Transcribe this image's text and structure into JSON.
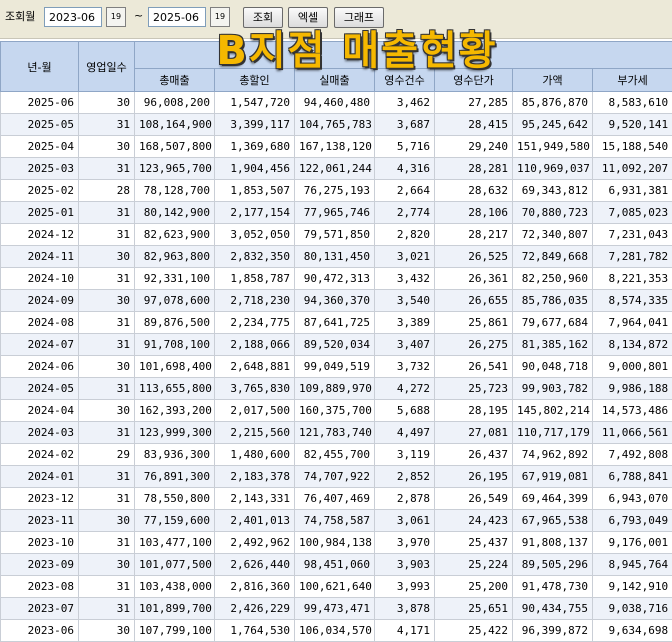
{
  "toolbar": {
    "period_label": "조회월",
    "start_month": "2023-06",
    "end_month": "2025-06",
    "separator": "~",
    "calendar_icon_text": "19",
    "search_label": "조회",
    "excel_label": "엑셀",
    "graph_label": "그래프"
  },
  "overlay_title": "B지점 매출현황",
  "columns": {
    "month": "년-월",
    "days": "영업일수",
    "group_hidden": "매",
    "total_sales": "총매출",
    "total_discount": "총할인",
    "net_sales": "실매출",
    "receipt_count": "영수건수",
    "unit_price": "영수단가",
    "price": "가액",
    "vat": "부가세"
  },
  "rows": [
    [
      "2025-06",
      "30",
      "96,008,200",
      "1,547,720",
      "94,460,480",
      "3,462",
      "27,285",
      "85,876,870",
      "8,583,610"
    ],
    [
      "2025-05",
      "31",
      "108,164,900",
      "3,399,117",
      "104,765,783",
      "3,687",
      "28,415",
      "95,245,642",
      "9,520,141"
    ],
    [
      "2025-04",
      "30",
      "168,507,800",
      "1,369,680",
      "167,138,120",
      "5,716",
      "29,240",
      "151,949,580",
      "15,188,540"
    ],
    [
      "2025-03",
      "31",
      "123,965,700",
      "1,904,456",
      "122,061,244",
      "4,316",
      "28,281",
      "110,969,037",
      "11,092,207"
    ],
    [
      "2025-02",
      "28",
      "78,128,700",
      "1,853,507",
      "76,275,193",
      "2,664",
      "28,632",
      "69,343,812",
      "6,931,381"
    ],
    [
      "2025-01",
      "31",
      "80,142,900",
      "2,177,154",
      "77,965,746",
      "2,774",
      "28,106",
      "70,880,723",
      "7,085,023"
    ],
    [
      "2024-12",
      "31",
      "82,623,900",
      "3,052,050",
      "79,571,850",
      "2,820",
      "28,217",
      "72,340,807",
      "7,231,043"
    ],
    [
      "2024-11",
      "30",
      "82,963,800",
      "2,832,350",
      "80,131,450",
      "3,021",
      "26,525",
      "72,849,668",
      "7,281,782"
    ],
    [
      "2024-10",
      "31",
      "92,331,100",
      "1,858,787",
      "90,472,313",
      "3,432",
      "26,361",
      "82,250,960",
      "8,221,353"
    ],
    [
      "2024-09",
      "30",
      "97,078,600",
      "2,718,230",
      "94,360,370",
      "3,540",
      "26,655",
      "85,786,035",
      "8,574,335"
    ],
    [
      "2024-08",
      "31",
      "89,876,500",
      "2,234,775",
      "87,641,725",
      "3,389",
      "25,861",
      "79,677,684",
      "7,964,041"
    ],
    [
      "2024-07",
      "31",
      "91,708,100",
      "2,188,066",
      "89,520,034",
      "3,407",
      "26,275",
      "81,385,162",
      "8,134,872"
    ],
    [
      "2024-06",
      "30",
      "101,698,400",
      "2,648,881",
      "99,049,519",
      "3,732",
      "26,541",
      "90,048,718",
      "9,000,801"
    ],
    [
      "2024-05",
      "31",
      "113,655,800",
      "3,765,830",
      "109,889,970",
      "4,272",
      "25,723",
      "99,903,782",
      "9,986,188"
    ],
    [
      "2024-04",
      "30",
      "162,393,200",
      "2,017,500",
      "160,375,700",
      "5,688",
      "28,195",
      "145,802,214",
      "14,573,486"
    ],
    [
      "2024-03",
      "31",
      "123,999,300",
      "2,215,560",
      "121,783,740",
      "4,497",
      "27,081",
      "110,717,179",
      "11,066,561"
    ],
    [
      "2024-02",
      "29",
      "83,936,300",
      "1,480,600",
      "82,455,700",
      "3,119",
      "26,437",
      "74,962,892",
      "7,492,808"
    ],
    [
      "2024-01",
      "31",
      "76,891,300",
      "2,183,378",
      "74,707,922",
      "2,852",
      "26,195",
      "67,919,081",
      "6,788,841"
    ],
    [
      "2023-12",
      "31",
      "78,550,800",
      "2,143,331",
      "76,407,469",
      "2,878",
      "26,549",
      "69,464,399",
      "6,943,070"
    ],
    [
      "2023-11",
      "30",
      "77,159,600",
      "2,401,013",
      "74,758,587",
      "3,061",
      "24,423",
      "67,965,538",
      "6,793,049"
    ],
    [
      "2023-10",
      "31",
      "103,477,100",
      "2,492,962",
      "100,984,138",
      "3,970",
      "25,437",
      "91,808,137",
      "9,176,001"
    ],
    [
      "2023-09",
      "30",
      "101,077,500",
      "2,626,440",
      "98,451,060",
      "3,903",
      "25,224",
      "89,505,296",
      "8,945,764"
    ],
    [
      "2023-08",
      "31",
      "103,438,000",
      "2,816,360",
      "100,621,640",
      "3,993",
      "25,200",
      "91,478,730",
      "9,142,910"
    ],
    [
      "2023-07",
      "31",
      "101,899,700",
      "2,426,229",
      "99,473,471",
      "3,878",
      "25,651",
      "90,434,755",
      "9,038,716"
    ],
    [
      "2023-06",
      "30",
      "107,799,100",
      "1,764,530",
      "106,034,570",
      "4,171",
      "25,422",
      "96,399,872",
      "9,634,698"
    ]
  ]
}
